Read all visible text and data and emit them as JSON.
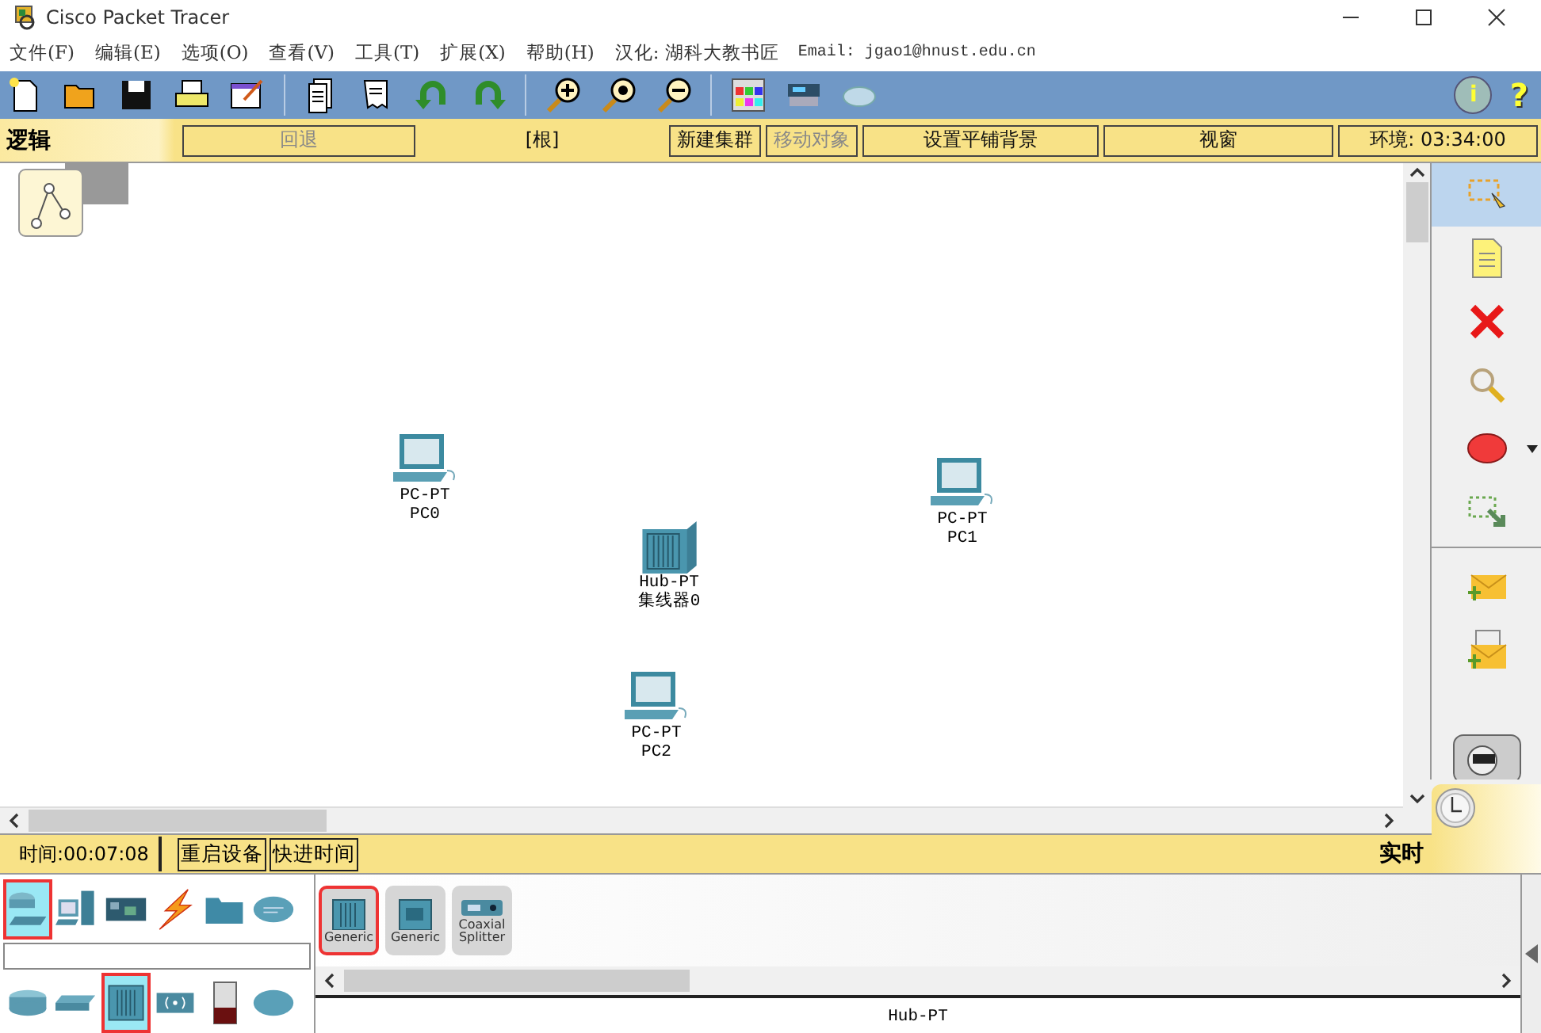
{
  "window": {
    "title": "Cisco Packet Tracer"
  },
  "menu": {
    "items": [
      "文件(F)",
      "编辑(E)",
      "选项(O)",
      "查看(V)",
      "工具(T)",
      "扩展(X)",
      "帮助(H)"
    ],
    "credit": "汉化: 湖科大教书匠",
    "email": "Email: jgao1@hnust.edu.cn"
  },
  "toolbar": {
    "info": "i",
    "help": "?"
  },
  "logic_bar": {
    "title": "逻辑",
    "buttons": [
      {
        "label": "回退",
        "kind": "button",
        "disabled": true
      },
      {
        "label": "[根]",
        "kind": "path",
        "disabled": false
      },
      {
        "label": "新建集群",
        "kind": "button",
        "disabled": false
      },
      {
        "label": "移动对象",
        "kind": "button",
        "disabled": true
      },
      {
        "label": "设置平铺背景",
        "kind": "button",
        "disabled": false
      },
      {
        "label": "视窗",
        "kind": "button",
        "disabled": false
      },
      {
        "label": "环境: 03:34:00",
        "kind": "button",
        "disabled": false
      }
    ]
  },
  "canvas": {
    "nodes": [
      {
        "kind": "pc",
        "model": "PC-PT",
        "name": "PC0"
      },
      {
        "kind": "pc",
        "model": "PC-PT",
        "name": "PC1"
      },
      {
        "kind": "hub",
        "model": "Hub-PT",
        "name": "集线器0"
      },
      {
        "kind": "pc",
        "model": "PC-PT",
        "name": "PC2"
      }
    ]
  },
  "tool_palette": [
    {
      "kind": "select",
      "selected": true
    },
    {
      "kind": "note",
      "selected": false
    },
    {
      "kind": "delete",
      "selected": false
    },
    {
      "kind": "inspect",
      "selected": false
    },
    {
      "kind": "shape",
      "selected": false
    },
    {
      "kind": "resize",
      "selected": false
    },
    {
      "kind": "simple-pdu",
      "selected": false
    },
    {
      "kind": "complex-pdu",
      "selected": false
    }
  ],
  "time_bar": {
    "time": "时间:00:07:08",
    "buttons": [
      "重启设备",
      "快进时间"
    ],
    "mode": "实时"
  },
  "device_categories": {
    "top": [
      {
        "kind": "network",
        "selected": true
      },
      {
        "kind": "end",
        "selected": false
      },
      {
        "kind": "component",
        "selected": false
      },
      {
        "kind": "connection",
        "selected": false
      },
      {
        "kind": "misc",
        "selected": false
      },
      {
        "kind": "multiuser",
        "selected": false
      }
    ],
    "bottom": [
      {
        "kind": "router",
        "selected": false
      },
      {
        "kind": "switch",
        "selected": false
      },
      {
        "kind": "hub",
        "selected": true
      },
      {
        "kind": "wireless",
        "selected": false
      },
      {
        "kind": "security",
        "selected": false
      },
      {
        "kind": "wan",
        "selected": false
      }
    ]
  },
  "device_list": [
    {
      "kind": "hub",
      "label": "Generic",
      "selected": true
    },
    {
      "kind": "repeater",
      "label": "Generic",
      "selected": false
    },
    {
      "kind": "splitter",
      "label": "Coaxial Splitter",
      "selected": false
    }
  ],
  "model_label": "Hub-PT"
}
